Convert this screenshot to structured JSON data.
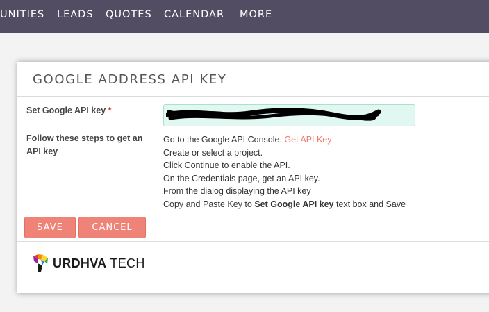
{
  "nav": {
    "items": [
      "UNITIES",
      "LEADS",
      "QUOTES",
      "CALENDAR",
      "MORE"
    ]
  },
  "panel": {
    "title": "GOOGLE ADDRESS API KEY",
    "api_key_label": "Set Google API key",
    "required_marker": "*",
    "api_key_value": "",
    "steps_label": "Follow these steps to get an API key",
    "steps": {
      "line1_text": "Go to the Google API Console. ",
      "line1_link": "Get API Key",
      "line2": "Create or select a project.",
      "line3": "Click Continue to enable the API.",
      "line4": "On the Credentials page, get an API key.",
      "line5": "From the dialog displaying the API key",
      "line6_pre": "Copy and Paste Key to ",
      "line6_bold": "Set Google API key",
      "line6_post": " text box and Save"
    },
    "save_label": "SAVE",
    "cancel_label": "CANCEL"
  },
  "logo": {
    "brand_bold": "URDHVA",
    "brand_rest": " TECH"
  },
  "colors": {
    "nav_bg": "#534d64",
    "button_bg": "#f08377",
    "link": "#ef7a6a",
    "input_bg": "#e1f7f1"
  }
}
